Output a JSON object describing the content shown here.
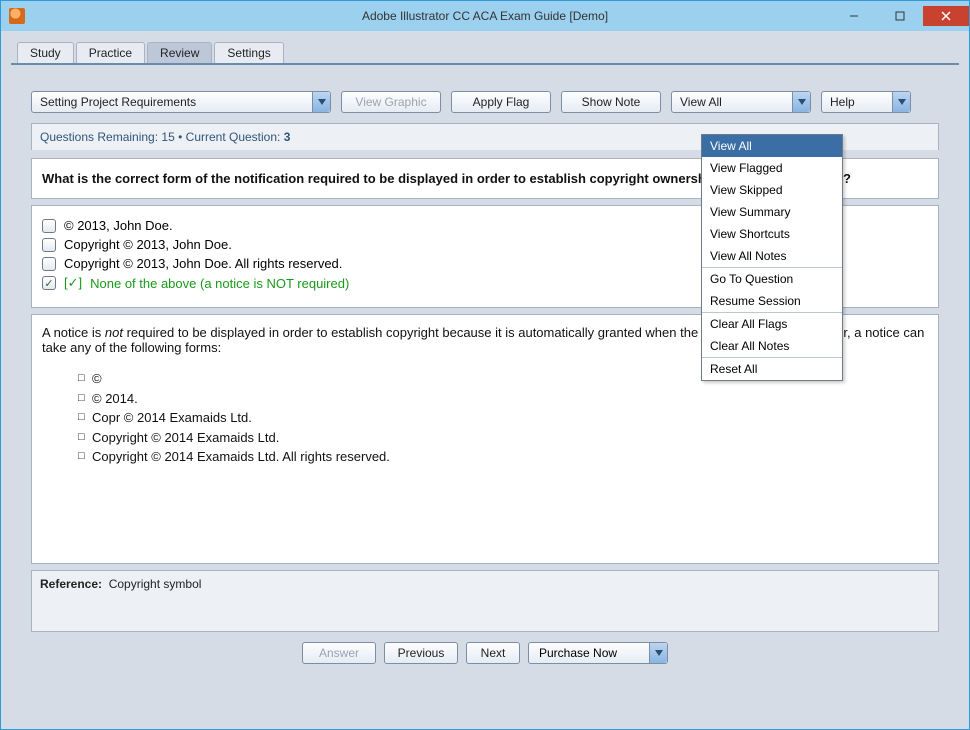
{
  "window": {
    "title": "Adobe Illustrator CC ACA Exam Guide [Demo]"
  },
  "tabs": {
    "study": "Study",
    "practice": "Practice",
    "review": "Review",
    "settings": "Settings",
    "active": "Review"
  },
  "toolbar": {
    "topic": "Setting Project Requirements",
    "view_graphic": "View Graphic",
    "apply_flag": "Apply Flag",
    "show_note": "Show Note",
    "view_all": "View All",
    "help": "Help"
  },
  "status": {
    "remaining_label": "Questions Remaining:",
    "remaining_value": "15",
    "bullet": "•",
    "current_label": "Current Question:",
    "current_value": "3"
  },
  "question": "What is the correct form of the notification required to be displayed in order to establish copyright ownership of a published work?",
  "answers": {
    "a": "© 2013, John Doe.",
    "b": "Copyright © 2013, John Doe.",
    "c": "Copyright © 2013, John Doe. All rights reserved.",
    "d_prefix": "[✓]",
    "d": "None of the above (a notice is NOT required)"
  },
  "explanation": {
    "p1a": "A notice is ",
    "p1_not": "not",
    "p1b": " required to be displayed in order to establish copyright because it is automatically granted when the work is created. However, a notice can take any of the following forms:",
    "items": {
      "i1": "©",
      "i2": "© 2014.",
      "i3": "Copr © 2014 Examaids Ltd.",
      "i4": "Copyright © 2014 Examaids Ltd.",
      "i5": "Copyright © 2014 Examaids Ltd. All rights reserved."
    }
  },
  "reference": {
    "label": "Reference:",
    "value": "Copyright symbol"
  },
  "bottom": {
    "answer": "Answer",
    "previous": "Previous",
    "next": "Next",
    "purchase": "Purchase Now"
  },
  "dropdown": {
    "view_all": "View All",
    "view_flagged": "View Flagged",
    "view_skipped": "View Skipped",
    "view_summary": "View Summary",
    "view_shortcuts": "View Shortcuts",
    "view_all_notes": "View All Notes",
    "go_to_question": "Go To Question",
    "resume_session": "Resume Session",
    "clear_all_flags": "Clear All Flags",
    "clear_all_notes": "Clear All Notes",
    "reset_all": "Reset All"
  }
}
